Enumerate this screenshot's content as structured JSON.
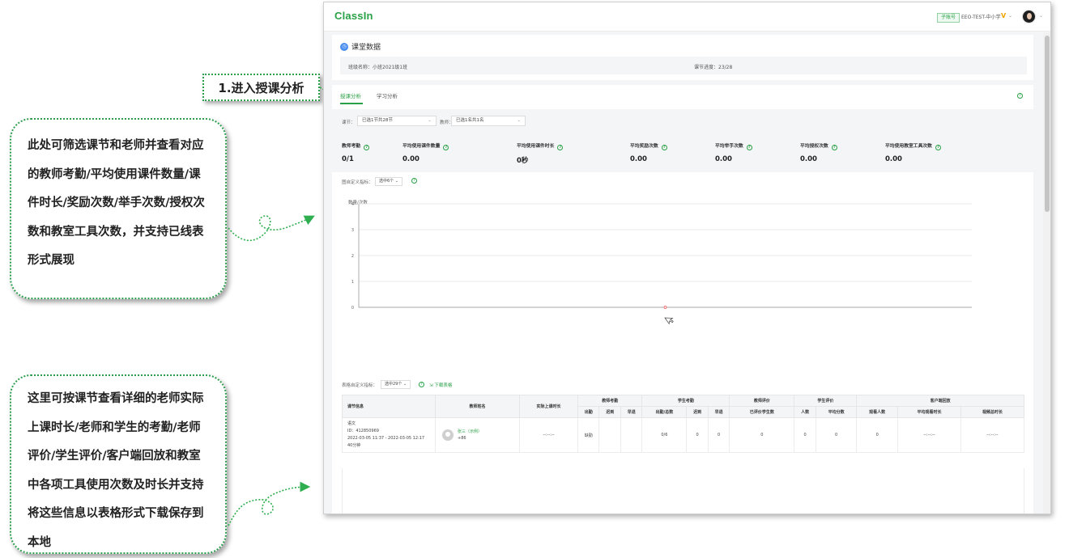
{
  "annotations": {
    "step_label": "1.进入授课分析",
    "callout_1": [
      "此处可筛选课节和老师并查看对应",
      "的教师考勤/平均使用课件数量/课",
      "件时长/奖励次数/举手次数/授权次",
      "数和教室工具次数，并支持已线表",
      "形式展现"
    ],
    "callout_2": [
      "这里可按课节查看详细的老师实际",
      "上课时长/老师和学生的考勤/老师",
      "评价/学生评价/客户端回放和教室",
      "中各项工具使用次数及时长并支持",
      "将这些信息以表格形式下载保存到",
      "本地"
    ]
  },
  "topbar": {
    "logo": "ClassIn",
    "role_badge": "子账号",
    "org_name": "EEO-TEST-中小学",
    "vip_mark": "V"
  },
  "header": {
    "title": "课堂数据",
    "class_label": "班级名称：小班2021级1班",
    "progress_label": "课节进度：23/28"
  },
  "tabs": [
    {
      "label": "授课分析",
      "active": true
    },
    {
      "label": "学习分析",
      "active": false
    }
  ],
  "filters": {
    "lesson_label": "课节：",
    "lesson_value": "已选1节共28节",
    "teacher_label": "教师：",
    "teacher_value": "已选1名共1名"
  },
  "metrics": [
    {
      "label": "教师考勤",
      "value": "0/1"
    },
    {
      "label": "平均使用课件数量",
      "value": "0.00"
    },
    {
      "label": "平均使用课件时长",
      "value": "0秒"
    },
    {
      "label": "平均奖励次数",
      "value": "0.00"
    },
    {
      "label": "平均举手次数",
      "value": "0.00"
    },
    {
      "label": "平均授权次数",
      "value": "0.00"
    },
    {
      "label": "平均使用教室工具次数",
      "value": "0.00"
    }
  ],
  "chart_controls": {
    "custom_label": "图自定义指标：",
    "custom_value": "选中6个"
  },
  "chart_data": {
    "type": "line",
    "ylabel": "数量/次数",
    "ylim": [
      0,
      4
    ],
    "yticks": [
      "0",
      "1",
      "2",
      "3",
      "4"
    ],
    "series": [
      {
        "values": [
          0
        ]
      }
    ],
    "grid": true
  },
  "table_controls": {
    "custom_label": "表格自定义指标：",
    "custom_value": "选中29个",
    "download_label": "下载表格"
  },
  "table": {
    "group_headers": [
      "课节信息",
      "教师姓名",
      "实际上课时长",
      "教师考勤",
      "学生考勤",
      "教师评价",
      "学生评价",
      "客户端回放"
    ],
    "sub_headers": {
      "teacher_attendance": [
        "出勤",
        "迟到",
        "早退"
      ],
      "student_attendance": [
        "出勤/总数",
        "迟到",
        "早退"
      ],
      "teacher_eval": [
        "已评价学生数"
      ],
      "student_eval": [
        "人数",
        "平均分数"
      ],
      "playback": [
        "观看人数",
        "平均观看时长",
        "视频总时长"
      ]
    },
    "row": {
      "lesson_name": "语文",
      "lesson_id": "ID：412850969",
      "lesson_time": "2022-03-05 11:37 - 2022-03-05 12:17",
      "lesson_duration": "40分钟",
      "teacher_name": "张三（示例）",
      "teacher_phone": "+86",
      "actual_duration": "--:--:--",
      "t_present": "缺勤",
      "t_late": "",
      "t_early": "",
      "s_present": "0/6",
      "s_late": "0",
      "s_early": "0",
      "eval_count": "0",
      "s_eval_count": "0",
      "s_eval_avg": "0",
      "watch_count": "0",
      "avg_watch": "--:--:--",
      "video_total": "--:--:--"
    }
  }
}
